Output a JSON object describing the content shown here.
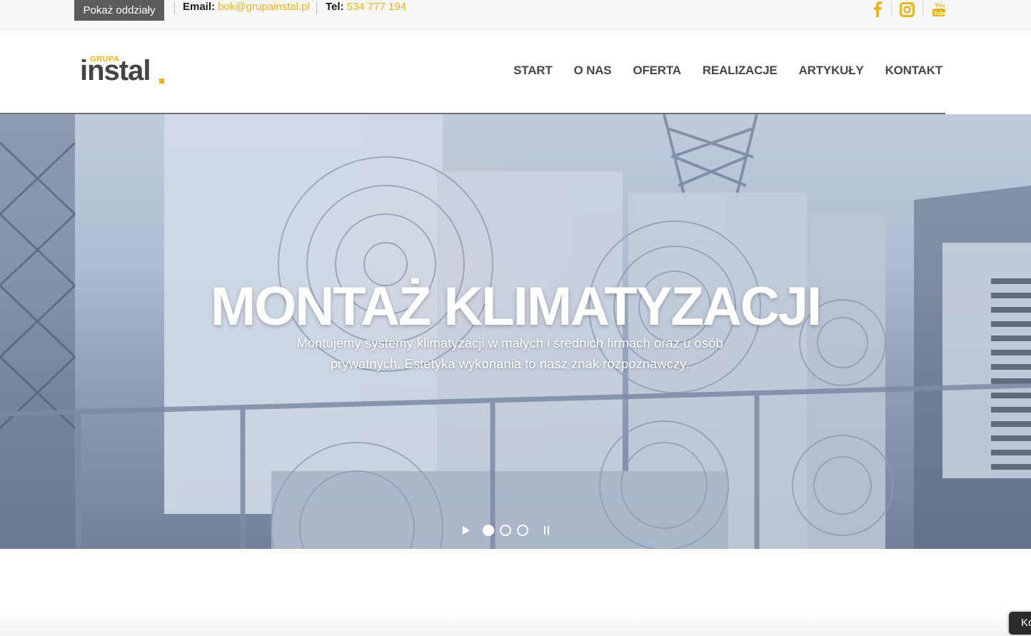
{
  "topbar": {
    "branches_label": "Pokaż oddziały",
    "email_label": "Email:",
    "email_value": "bok@grupainstal.pl",
    "tel_label": "Tel:",
    "tel_value": "534 777 194",
    "social": [
      "facebook-icon",
      "instagram-icon",
      "youtube-icon"
    ]
  },
  "logo": {
    "small": "GRUPA",
    "main": "instal"
  },
  "nav": {
    "items": [
      "START",
      "O NAS",
      "OFERTA",
      "REALIZACJE",
      "ARTYKUŁY",
      "KONTAKT"
    ]
  },
  "hero": {
    "title": "MONTAŻ KLIMATYZACJI",
    "subtitle": "Montujemy systemy klimatyzacji w małych i średnich firmach oraz u osób prywatnych. Estetyka wykonania to nasz znak rozpoznawczy.",
    "slide_count": 3,
    "active_slide": 1
  },
  "chat": {
    "label": "Ko"
  },
  "colors": {
    "accent": "#e8b321",
    "nav_text": "#474747",
    "top_button": "#5b5b5b"
  }
}
